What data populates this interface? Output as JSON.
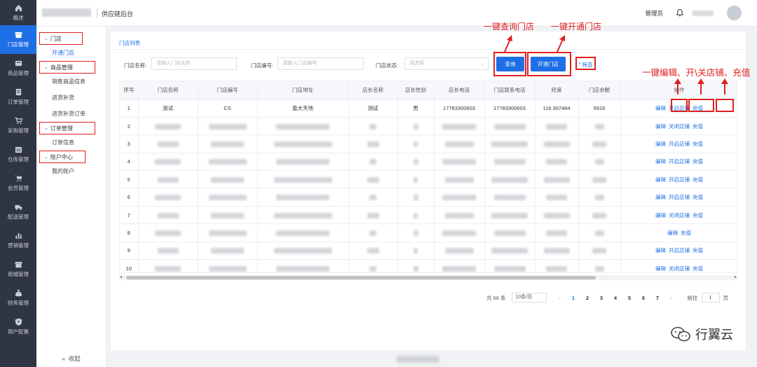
{
  "nav": {
    "items": [
      {
        "label": "概述",
        "icon": "home-icon",
        "active": false
      },
      {
        "label": "门店管理",
        "icon": "store-icon",
        "active": true
      },
      {
        "label": "商品管理",
        "icon": "goods-icon",
        "active": false
      },
      {
        "label": "订单管理",
        "icon": "order-icon",
        "active": false
      },
      {
        "label": "采购管理",
        "icon": "cart-icon",
        "active": false
      },
      {
        "label": "仓库管理",
        "icon": "warehouse-icon",
        "active": false
      },
      {
        "label": "会员管理",
        "icon": "member-cart-icon",
        "active": false
      },
      {
        "label": "配送管理",
        "icon": "truck-icon",
        "active": false
      },
      {
        "label": "营销管理",
        "icon": "bar-chart-icon",
        "active": false
      },
      {
        "label": "商城管理",
        "icon": "shop-icon",
        "active": false
      },
      {
        "label": "财务管理",
        "icon": "money-bag-icon",
        "active": false
      },
      {
        "label": "用户配置",
        "icon": "shield-icon",
        "active": false
      }
    ]
  },
  "header": {
    "title": "供应链后台",
    "admin": "管理员"
  },
  "submenu": {
    "groups": [
      {
        "label": "门店",
        "items": [
          "开通门店"
        ]
      },
      {
        "label": "商品管理",
        "items": [
          "销售商品信息",
          "进货补货",
          "进货补货订单"
        ]
      },
      {
        "label": "订单管理",
        "items": [
          "订单信息"
        ]
      },
      {
        "label": "账户中心",
        "items": [
          "我的账户"
        ]
      }
    ],
    "collapse": "收起"
  },
  "page": {
    "card_title": "门店列表",
    "filters": {
      "name_label": "门店名称:",
      "name_placeholder": "请输入门店名称",
      "code_label": "门店编号:",
      "code_placeholder": "请输入门店编号:",
      "status_label": "门店状态:",
      "status_placeholder": "请选择"
    },
    "buttons": {
      "query": "查询",
      "open": "开通门店",
      "filter": "筛选"
    }
  },
  "table": {
    "headers": [
      "序号",
      "门店名称",
      "门店编号",
      "门店地址",
      "店长名称",
      "店长性别",
      "店长电话",
      "门店联系电话",
      "经度",
      "门店余额",
      "操作"
    ],
    "first_row": {
      "idx": "1",
      "name": "测试",
      "code": "CS",
      "address": "盈大天地",
      "manager": "测试",
      "gender": "男",
      "phone": "17783300603",
      "contact": "17783300603",
      "longitude": "116.307484",
      "balance": "9916"
    },
    "row_indices": [
      "2",
      "3",
      "4",
      "5",
      "6",
      "7",
      "8",
      "9",
      "10"
    ],
    "ops_row1": [
      "编辑",
      "开启店铺",
      "充值"
    ],
    "ops": [
      [
        "编辑",
        "关闭店铺",
        "充值"
      ],
      [
        "编辑",
        "开启店铺",
        "充值"
      ],
      [
        "编辑",
        "开启店铺",
        "充值"
      ],
      [
        "编辑",
        "开启店铺",
        "充值"
      ],
      [
        "编辑",
        "开启店铺",
        "充值"
      ],
      [
        "编辑",
        "关闭店铺",
        "充值"
      ],
      [
        "编辑",
        "充值"
      ],
      [
        "编辑",
        "开启店铺",
        "充值"
      ],
      [
        "编辑",
        "关闭店铺",
        "充值"
      ]
    ],
    "ops_header_partial": "操作"
  },
  "pager": {
    "total": "共 66 条",
    "size": "10条/页",
    "pages": [
      "1",
      "2",
      "3",
      "4",
      "5",
      "6",
      "7"
    ],
    "current": "1",
    "goto_label": "前往",
    "goto_value": "1",
    "page_suffix": "页"
  },
  "annotations": {
    "query": "一键查询门店",
    "open": "一键开通门店",
    "ops": "一键编辑、开\\关店铺、充值"
  },
  "watermark": "行翼云",
  "colors": {
    "accent": "#1e6fe6",
    "nav_bg": "#2f3542",
    "annotation": "#e02020"
  }
}
